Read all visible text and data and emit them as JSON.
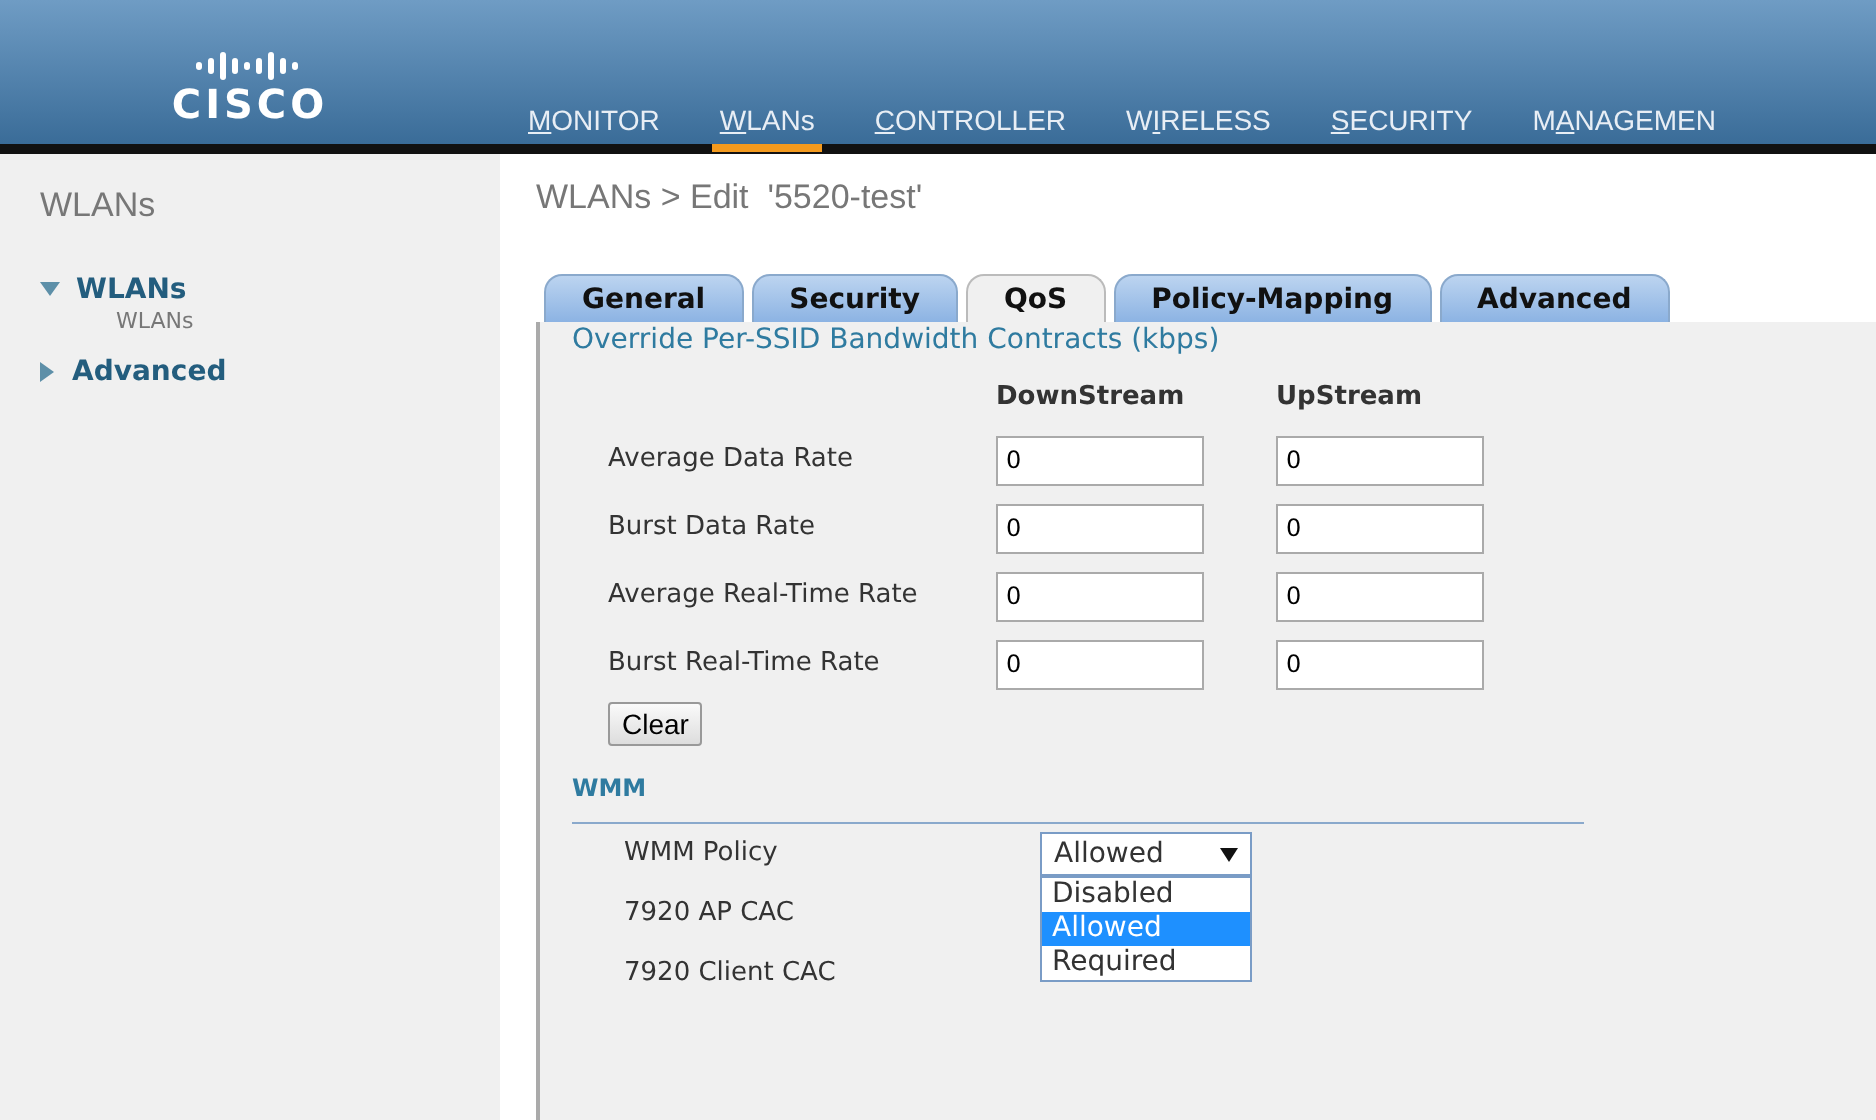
{
  "header": {
    "logo": "CISCO",
    "menu": [
      {
        "segments": [
          {
            "text": "M",
            "underlined": true
          },
          {
            "text": "ONITOR",
            "underlined": false
          }
        ],
        "selected": false
      },
      {
        "segments": [
          {
            "text": "W",
            "underlined": true
          },
          {
            "text": "LANs",
            "underlined": false
          }
        ],
        "selected": true
      },
      {
        "segments": [
          {
            "text": "C",
            "underlined": true
          },
          {
            "text": "ONTROLLER",
            "underlined": false
          }
        ],
        "selected": false
      },
      {
        "segments": [
          {
            "text": "W",
            "underlined": false
          },
          {
            "text": "I",
            "underlined": true
          },
          {
            "text": "RELESS",
            "underlined": false
          }
        ],
        "selected": false
      },
      {
        "segments": [
          {
            "text": "S",
            "underlined": true
          },
          {
            "text": "ECURITY",
            "underlined": false
          }
        ],
        "selected": false
      },
      {
        "segments": [
          {
            "text": "M",
            "underlined": false
          },
          {
            "text": "A",
            "underlined": true
          },
          {
            "text": "NAGEMEN",
            "underlined": false
          }
        ],
        "selected": false
      }
    ]
  },
  "sidebar": {
    "title": "WLANs",
    "items": [
      {
        "label": "WLANs",
        "expanded": true,
        "children": [
          {
            "label": "WLANs"
          }
        ]
      },
      {
        "label": "Advanced",
        "expanded": false
      }
    ]
  },
  "page_title": "WLANs > Edit  '5520-test'",
  "tabs": [
    {
      "label": "General",
      "selected": false
    },
    {
      "label": "Security",
      "selected": false
    },
    {
      "label": "QoS",
      "selected": true
    },
    {
      "label": "Policy-Mapping",
      "selected": false
    },
    {
      "label": "Advanced",
      "selected": false
    }
  ],
  "bandwidth": {
    "heading": "Override Per-SSID Bandwidth Contracts (kbps)",
    "columns": [
      "DownStream",
      "UpStream"
    ],
    "rows": [
      {
        "label": "Average Data Rate",
        "downstream": "0",
        "upstream": "0"
      },
      {
        "label": "Burst Data Rate",
        "downstream": "0",
        "upstream": "0"
      },
      {
        "label": "Average Real-Time Rate",
        "downstream": "0",
        "upstream": "0"
      },
      {
        "label": "Burst Real-Time Rate",
        "downstream": "0",
        "upstream": "0"
      }
    ],
    "clear_button": "Clear"
  },
  "wmm": {
    "heading": "WMM",
    "policy_label": "WMM Policy",
    "policy_value": "Allowed",
    "options": [
      {
        "label": "Disabled",
        "selected": false
      },
      {
        "label": "Allowed",
        "selected": true
      },
      {
        "label": "Required",
        "selected": false
      }
    ],
    "fields": [
      {
        "label": "7920 AP CAC"
      },
      {
        "label": "7920 Client CAC"
      }
    ]
  }
}
